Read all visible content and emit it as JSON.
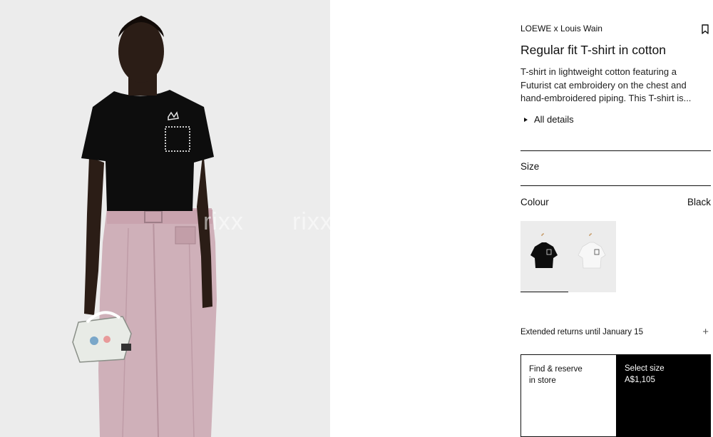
{
  "hero": {
    "watermarks": [
      "rixx",
      "rixx"
    ]
  },
  "product": {
    "collab": "LOEWE x Louis Wain",
    "bookmark_icon": "bookmark-icon",
    "title": "Regular fit T-shirt in cotton",
    "description": "T-shirt in lightweight cotton featuring a Futurist cat embroidery on the chest and hand-embroidered piping. This T-shirt is...",
    "details_label": "All details"
  },
  "options": {
    "size_label": "Size",
    "colour_label": "Colour",
    "colour_value": "Black",
    "swatches": [
      {
        "name": "Black",
        "color": "#111111",
        "selected": true
      },
      {
        "name": "White",
        "color": "#f4f4f4",
        "selected": false
      }
    ]
  },
  "returns": {
    "label": "Extended returns until January 15",
    "icon": "plus-icon"
  },
  "actions": {
    "find_line1": "Find & reserve",
    "find_line2": "in store",
    "select_label": "Select size",
    "price": "A$1,105"
  },
  "colors": {
    "background": "#ffffff",
    "image_bg": "#ececec",
    "text": "#111111",
    "cta_bg": "#000000",
    "shirt": "#0d0d0d",
    "trousers": "#c9a8b2"
  }
}
